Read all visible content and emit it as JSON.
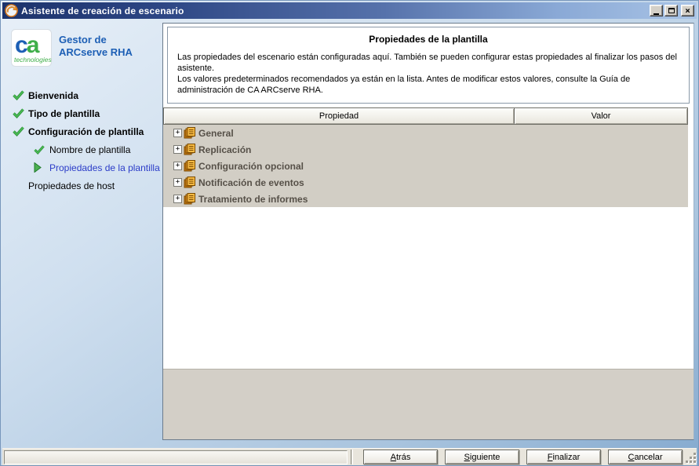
{
  "window": {
    "title": "Asistente de creación de escenario"
  },
  "icons": {
    "expand": "+",
    "close": "×"
  },
  "branding": {
    "logo_main": "ca",
    "logo_sub": "technologies",
    "app_line1": "Gestor de",
    "app_line2": "ARCserve RHA"
  },
  "steps": [
    {
      "label": "Bienvenida",
      "state": "done",
      "level": 0
    },
    {
      "label": "Tipo de plantilla",
      "state": "done",
      "level": 0
    },
    {
      "label": "Configuración de plantilla",
      "state": "done",
      "level": 0
    },
    {
      "label": "Nombre de plantilla",
      "state": "done",
      "level": 1
    },
    {
      "label": "Propiedades de la plantilla",
      "state": "current",
      "level": 1
    },
    {
      "label": "Propiedades de host",
      "state": "pending",
      "level": 0
    }
  ],
  "content": {
    "title": "Propiedades de la plantilla",
    "description_lines": [
      "Las propiedades del escenario están configuradas aquí. También se pueden configurar estas propiedades al finalizar los pasos del asistente.",
      "Los valores predeterminados recomendados ya están en la lista. Antes de modificar estos valores, consulte la Guía de administración de CA ARCserve RHA."
    ],
    "table": {
      "columns": [
        "Propiedad",
        "Valor"
      ],
      "groups": [
        "General",
        "Replicación",
        "Configuración opcional",
        "Notificación de eventos",
        "Tratamiento de informes"
      ]
    }
  },
  "buttons": [
    {
      "label": "Atrás"
    },
    {
      "label": "Siguiente"
    },
    {
      "label": "Finalizar"
    },
    {
      "label": "Cancelar"
    }
  ],
  "colors": {
    "titlebar_left": "#1c336b",
    "titlebar_right": "#a9c4e6",
    "brand_blue": "#1d5fb5",
    "active_step_blue": "#2b3cc8",
    "check_green": "#35a33f",
    "pages_icon_orange": "#f2a230",
    "row_bg": "#d2cec5",
    "footer_bg": "#d3cfc7"
  }
}
